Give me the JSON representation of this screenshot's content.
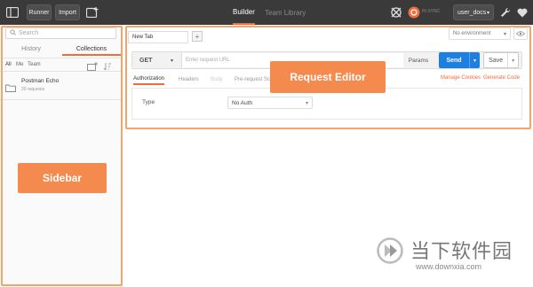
{
  "topbar": {
    "runner_label": "Runner",
    "import_label": "Import",
    "builder_label": "Builder",
    "team_library_label": "Team Library",
    "sync_label": "IN SYNC",
    "user_label": "user_docs"
  },
  "sidebar": {
    "search_placeholder": "Search",
    "tabs": [
      {
        "label": "History"
      },
      {
        "label": "Collections"
      }
    ],
    "filters": [
      "All",
      "Me",
      "Team"
    ],
    "collections": [
      {
        "name": "Postman Echo",
        "count": "20 requests"
      }
    ],
    "callout_label": "Sidebar"
  },
  "editor": {
    "tab_label": "New Tab",
    "add_tab_label": "+",
    "environment_label": "No environment",
    "method": "GET",
    "url_placeholder": "Enter request URL",
    "params_label": "Params",
    "send_label": "Send",
    "save_label": "Save",
    "subtabs": [
      {
        "label": "Authorization"
      },
      {
        "label": "Headers"
      },
      {
        "label": "Body"
      },
      {
        "label": "Pre-request Scri"
      }
    ],
    "manage_cookies_label": "Manage Cookies",
    "generate_code_label": "Generate Code",
    "type_label": "Type",
    "auth_type_value": "No Auth",
    "callout_label": "Request Editor"
  },
  "watermark": {
    "chinese_text": "当下软件园",
    "url_text": "www.downxia.com"
  },
  "colors": {
    "accent": "#f26b3a",
    "callout": "#f58a4e",
    "send": "#1f7fe0",
    "topbar": "#3a3a3a"
  }
}
